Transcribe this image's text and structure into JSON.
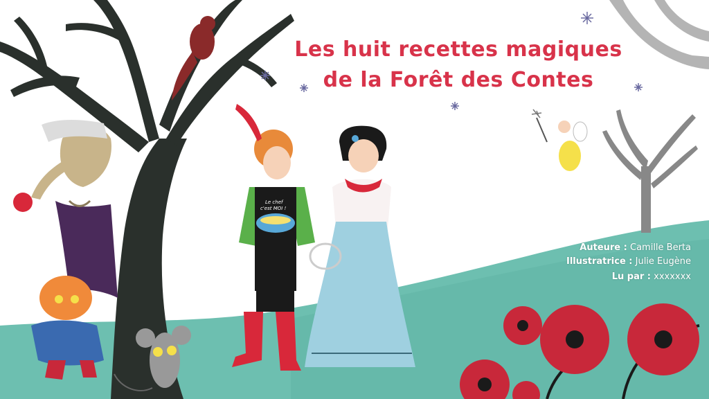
{
  "title": {
    "line1": "Les huit recettes magiques",
    "line2": "de la Forêt des Contes"
  },
  "credits": {
    "author_label": "Auteure :",
    "author_name": "Camille Berta",
    "illustrator_label": "Illustratrice :",
    "illustrator_name": "Julie Eugène",
    "reader_label": "Lu par :",
    "reader_name": "xxxxxxx"
  },
  "apron": {
    "line1": "Le chef",
    "line2": "c'est MOI !"
  },
  "colors": {
    "title": "#d8334a",
    "hill": "#6dbfb0",
    "tree": "#2a302c",
    "poppy": "#c8283a",
    "dress": "#9fd0e0"
  },
  "icons": [
    "sparkle-star-icon",
    "magic-wand-icon"
  ]
}
